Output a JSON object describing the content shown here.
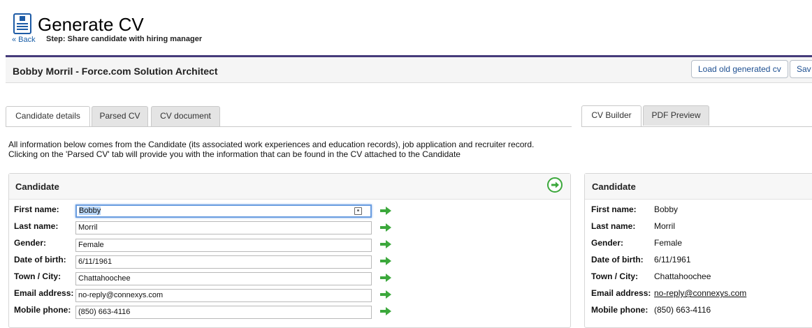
{
  "header": {
    "title": "Generate CV",
    "back_link": "« Back",
    "step_text": "Step: Share candidate with hiring manager"
  },
  "record": {
    "title": "Bobby Morril - Force.com Solution Architect",
    "buttons": {
      "load_old": "Load old generated cv",
      "save": "Sav"
    }
  },
  "left_tabs": [
    "Candidate details",
    "Parsed CV",
    "CV document"
  ],
  "right_tabs": [
    "CV Builder",
    "PDF Preview"
  ],
  "info_lines": [
    "All information below comes from the Candidate (its associated work experiences and education records), job application and recruiter record.",
    "Clicking on the 'Parsed CV' tab will provide you with the information that can be found in the CV attached to the Candidate"
  ],
  "candidate_form": {
    "title": "Candidate",
    "fields": [
      {
        "label": "First name:",
        "value": "Bobby"
      },
      {
        "label": "Last name:",
        "value": "Morril"
      },
      {
        "label": "Gender:",
        "value": "Female"
      },
      {
        "label": "Date of birth:",
        "value": "6/11/1961"
      },
      {
        "label": "Town / City:",
        "value": "Chattahoochee"
      },
      {
        "label": "Email address:",
        "value": "no-reply@connexys.com"
      },
      {
        "label": "Mobile phone:",
        "value": "(850) 663-4116"
      }
    ]
  },
  "cv_builder": {
    "title": "Candidate",
    "rows": [
      {
        "label": "First name:",
        "value": "Bobby"
      },
      {
        "label": "Last name:",
        "value": "Morril"
      },
      {
        "label": "Gender:",
        "value": "Female"
      },
      {
        "label": "Date of birth:",
        "value": "6/11/1961"
      },
      {
        "label": "Town / City:",
        "value": "Chattahoochee"
      },
      {
        "label": "Email address:",
        "value": "no-reply@connexys.com"
      },
      {
        "label": "Mobile phone:",
        "value": "(850) 663-4116"
      }
    ]
  },
  "icons": {
    "page": "document-icon",
    "field_arrow": "green-arrow-right-icon",
    "copy_all": "circle-arrow-icon",
    "contact": "contact-card-icon"
  },
  "colors": {
    "accent_rule": "#453b7a",
    "link": "#1a5fa8",
    "arrow_green": "#3ca83c"
  }
}
